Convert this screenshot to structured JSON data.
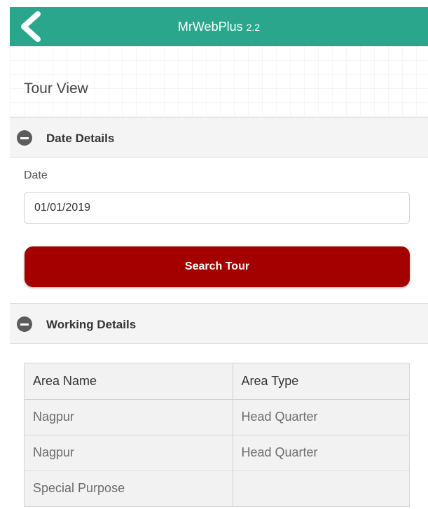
{
  "header": {
    "title": "MrWebPlus",
    "version": "2.2"
  },
  "page": {
    "title": "Tour View"
  },
  "date_section": {
    "title": "Date Details",
    "date_label": "Date",
    "date_value": "01/01/2019"
  },
  "actions": {
    "search_label": "Search Tour"
  },
  "working_section": {
    "title": "Working Details"
  },
  "table": {
    "headers": [
      "Area Name",
      "Area Type"
    ],
    "rows": [
      [
        "Nagpur",
        "Head Quarter"
      ],
      [
        "Nagpur",
        "Head Quarter"
      ],
      [
        "Special Purpose",
        ""
      ]
    ]
  },
  "colors": {
    "header_bg": "#2aa68c",
    "button_bg": "#a40000",
    "icon_grey": "#5c5c5c"
  },
  "icons": {
    "back": "chevron-left-icon",
    "collapse": "minus-circle-icon"
  }
}
